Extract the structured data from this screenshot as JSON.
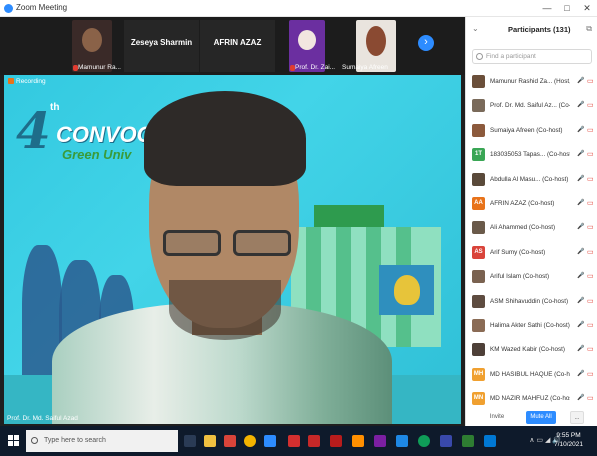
{
  "window": {
    "title": "Zoom Meeting",
    "controls": [
      "—",
      "□",
      "✕"
    ]
  },
  "gallery_strip": {
    "thumbnails": [
      {
        "name": "Mamunur Ra..."
      },
      {
        "name": "Zeseya Sharmin"
      },
      {
        "name": "AFRIN AZAZ"
      },
      {
        "name": "Prof. Dr. Zai..."
      },
      {
        "name": "Sumaiya Afreen"
      }
    ],
    "next_label": "›"
  },
  "main_video": {
    "recording_label": "Recording",
    "banner_number": "4",
    "banner_suffix": "th",
    "banner_word": "CONVOCATI",
    "banner_subtitle": "Green Univ",
    "speaker_name": "Prof. Dr. Md. Saiful Azad"
  },
  "participants": {
    "title": "Participants (131)",
    "search_placeholder": "Find a participant",
    "items": [
      {
        "name": "Mamunur Rashid Za... (Host, me)",
        "avatar": "",
        "avatar_color": "#6b4f3a"
      },
      {
        "name": "Prof. Dr. Md. Saiful Az... (Co-host)",
        "avatar": "",
        "avatar_color": "#7a6a5a"
      },
      {
        "name": "Sumaiya Afreen (Co-host)",
        "avatar": "",
        "avatar_color": "#8c5a3c"
      },
      {
        "name": "183035053 Tapas... (Co-host)",
        "avatar": "1T",
        "avatar_color": "#3aa655"
      },
      {
        "name": "Abdulla Al Masu... (Co-host)",
        "avatar": "",
        "avatar_color": "#5a4a3a"
      },
      {
        "name": "AFRIN AZAZ (Co-host)",
        "avatar": "AA",
        "avatar_color": "#e8731a"
      },
      {
        "name": "Ali Ahammed (Co-host)",
        "avatar": "",
        "avatar_color": "#6a5a4a"
      },
      {
        "name": "Arif Sumy (Co-host)",
        "avatar": "AS",
        "avatar_color": "#d9443a"
      },
      {
        "name": "Ariful Islam (Co-host)",
        "avatar": "",
        "avatar_color": "#7a6250"
      },
      {
        "name": "ASM Shihavuddin (Co-host)",
        "avatar": "",
        "avatar_color": "#5e4c40"
      },
      {
        "name": "Halima Akter Sathi (Co-host)",
        "avatar": "",
        "avatar_color": "#8a6b55"
      },
      {
        "name": "KM Wazed Kabir (Co-host)",
        "avatar": "",
        "avatar_color": "#4e4038"
      },
      {
        "name": "MD HASIBUL HAQUE (Co-host)",
        "avatar": "MH",
        "avatar_color": "#f0a030"
      },
      {
        "name": "MD NAZIR MAHFUZ (Co-host)",
        "avatar": "MN",
        "avatar_color": "#f0a030"
      }
    ],
    "invite_label": "Invite",
    "mute_all_label": "Mute All",
    "more_label": "..."
  },
  "taskbar": {
    "search_placeholder": "Type here to search",
    "time": "9:55 PM",
    "date": "7/10/2021"
  }
}
